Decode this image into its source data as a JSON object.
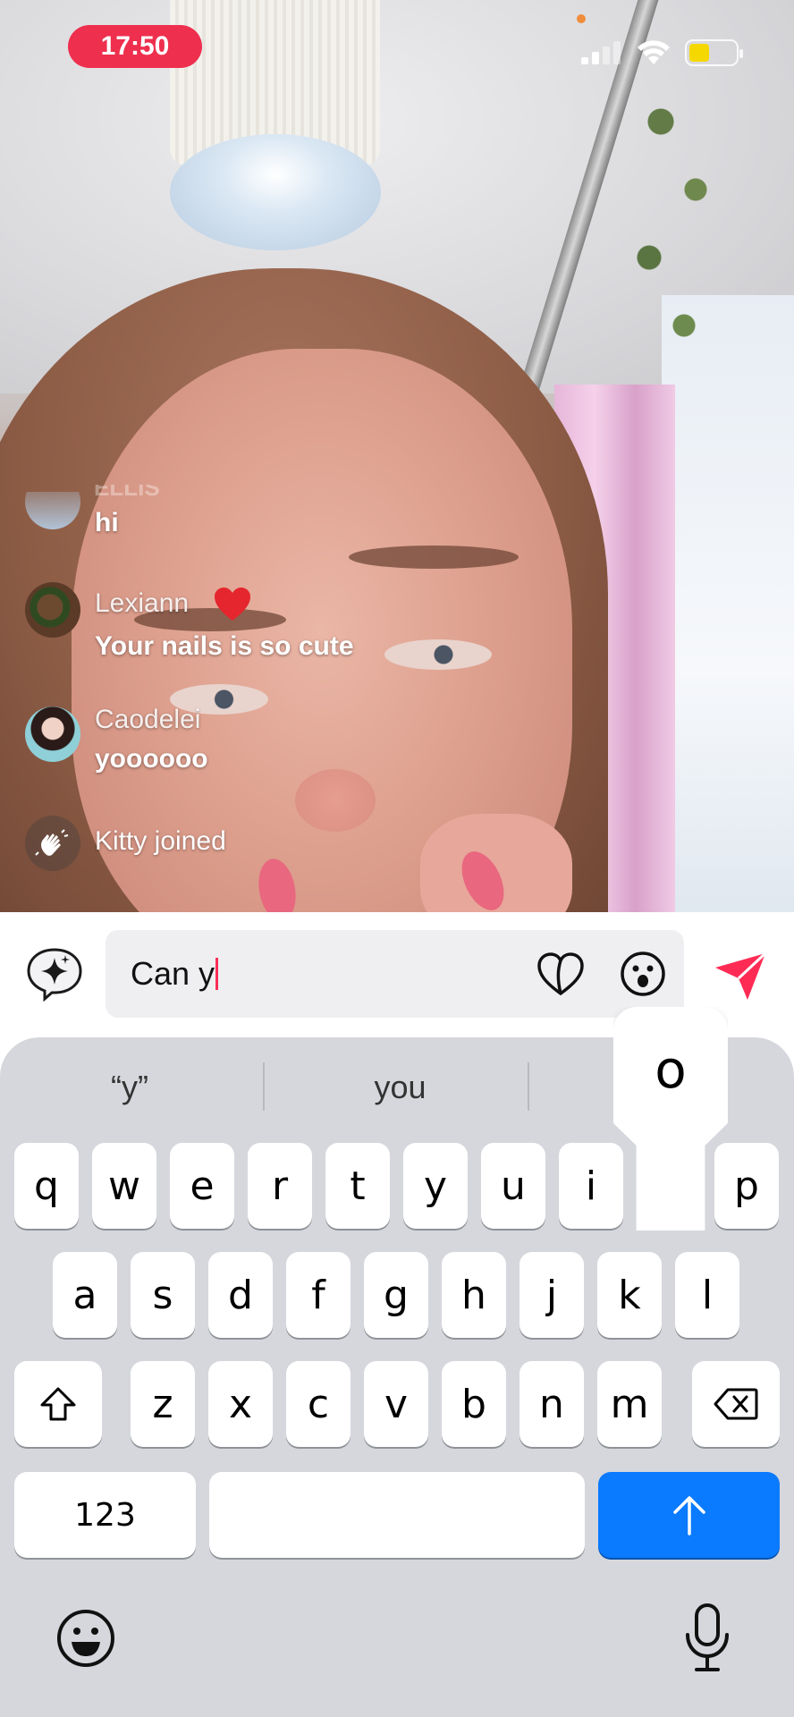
{
  "status_bar": {
    "time": "17:50",
    "battery_color": "#f5d800",
    "time_pill_color": "#ee2f4d"
  },
  "comments": [
    {
      "user": "",
      "text": "hi"
    },
    {
      "user": "Lexiann",
      "badge": "heart",
      "text": "Your nails is so cute"
    },
    {
      "user": "Caodelei",
      "text": "yoooooo"
    },
    {
      "user": "",
      "text": "Kitty joined",
      "icon": "waving-hand-icon"
    }
  ],
  "compose": {
    "input_value": "Can y",
    "buttons": [
      "ai-sparkle",
      "heart",
      "emoji",
      "send"
    ],
    "send_color": "#fe2c55"
  },
  "keyboard": {
    "suggestions": [
      "“y”",
      "you"
    ],
    "popup_key": "o",
    "row1": [
      "q",
      "w",
      "e",
      "r",
      "t",
      "y",
      "u",
      "i",
      "p"
    ],
    "row2": [
      "a",
      "s",
      "d",
      "f",
      "g",
      "h",
      "j",
      "k",
      "l"
    ],
    "row3": [
      "z",
      "x",
      "c",
      "v",
      "b",
      "n",
      "m"
    ],
    "numbers_label": "123",
    "return_color": "#0a7aff"
  }
}
